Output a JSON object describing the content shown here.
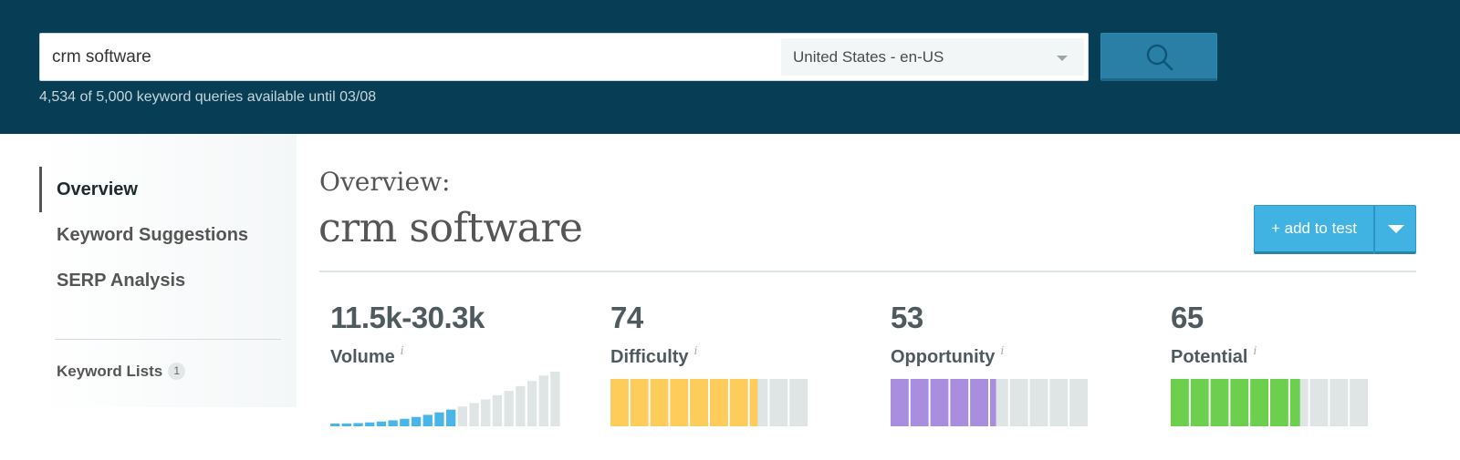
{
  "search": {
    "query": "crm software",
    "locale": "United States - en-US",
    "quota": "4,534 of 5,000 keyword queries available until 03/08"
  },
  "sidebar": {
    "items": [
      {
        "label": "Overview",
        "active": true
      },
      {
        "label": "Keyword Suggestions",
        "active": false
      },
      {
        "label": "SERP Analysis",
        "active": false
      }
    ],
    "keyword_lists": {
      "label": "Keyword Lists",
      "count": "1"
    }
  },
  "main": {
    "overview_label": "Overview:",
    "keyword": "crm software",
    "add_button": "+ add to test"
  },
  "metrics": [
    {
      "value": "11.5k-30.3k",
      "label": "Volume",
      "info": "i",
      "type": "volume",
      "color": "#4ab6e8",
      "filled_bars": 11,
      "total_bars": 20
    },
    {
      "value": "74",
      "label": "Difficulty",
      "info": "i",
      "type": "score",
      "score": 74,
      "color": "#fdcc5a"
    },
    {
      "value": "53",
      "label": "Opportunity",
      "info": "i",
      "type": "score",
      "score": 53,
      "color": "#a98ee0"
    },
    {
      "value": "65",
      "label": "Potential",
      "info": "i",
      "type": "score",
      "score": 65,
      "color": "#6ccf4e"
    }
  ],
  "colors": {
    "header_bg": "#073e55",
    "search_button": "#2a7fa6",
    "accent_blue": "#41b3e3",
    "empty_bar": "#dfe4e5"
  }
}
